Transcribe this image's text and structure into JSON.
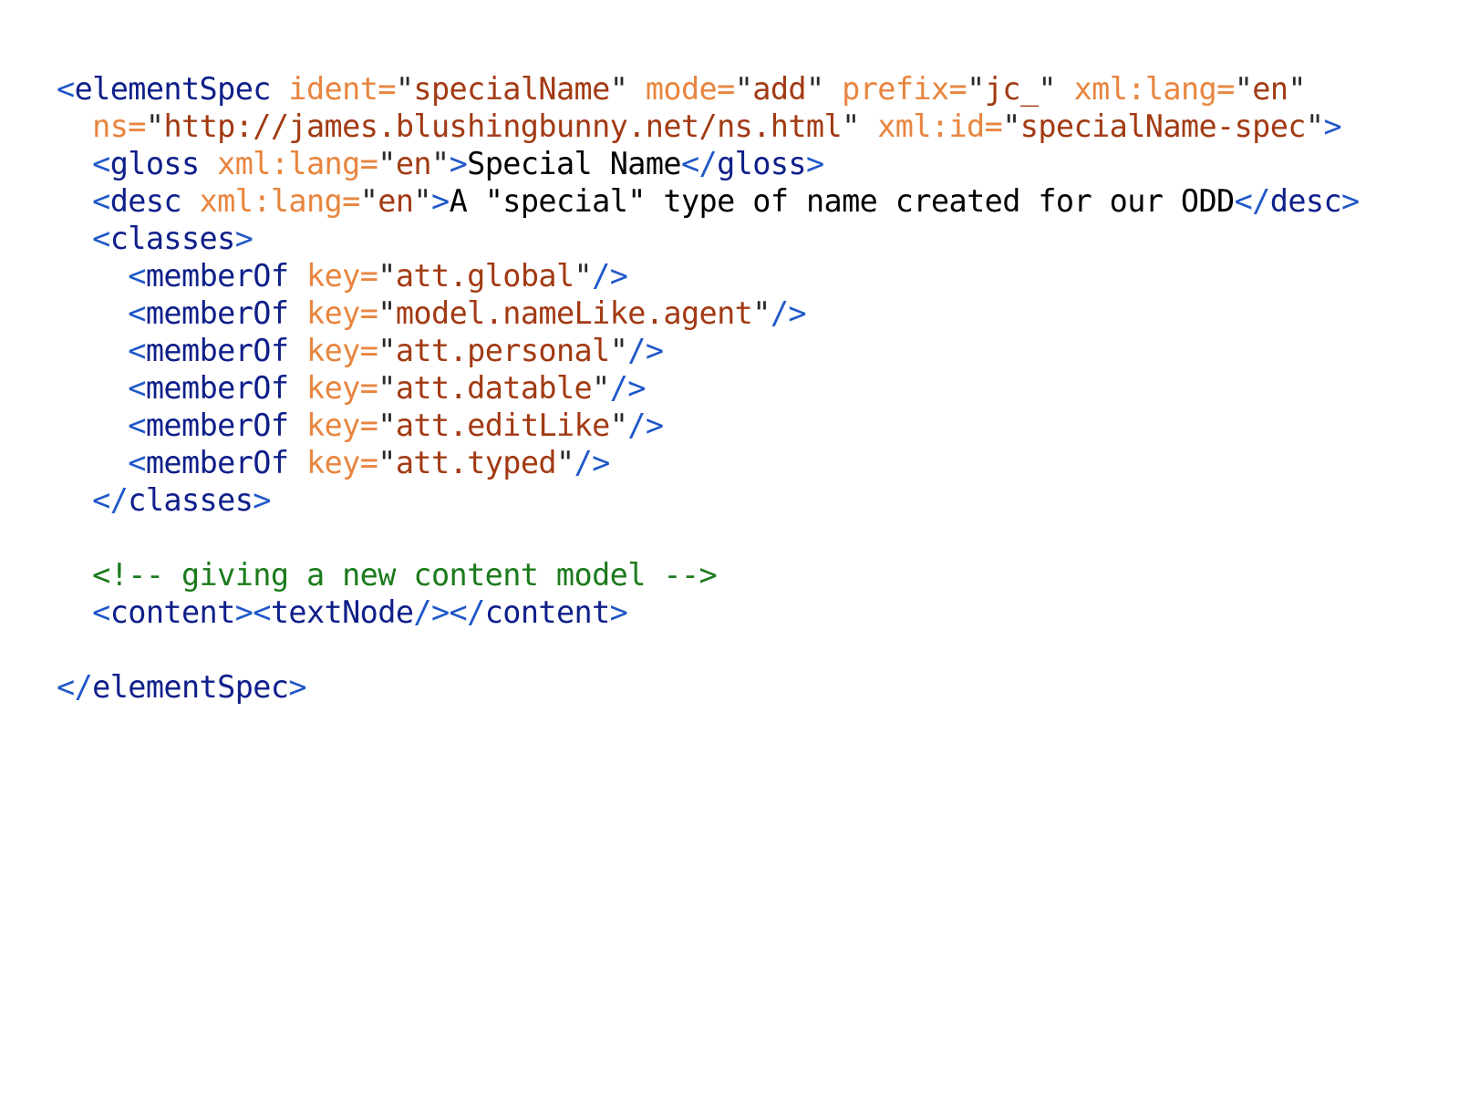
{
  "colors": {
    "punct": "#1f58c9",
    "element": "#0f1f8a",
    "attribute": "#e8853f",
    "value": "#a23a13",
    "text": "#000000",
    "comment": "#1b7a1b",
    "background": "#ffffff"
  },
  "lines": [
    [
      {
        "t": "punct",
        "v": "<"
      },
      {
        "t": "elem",
        "v": "elementSpec"
      },
      {
        "t": "space",
        "v": " "
      },
      {
        "t": "attr",
        "v": "ident="
      },
      {
        "t": "quote",
        "v": "\""
      },
      {
        "t": "val",
        "v": "specialName"
      },
      {
        "t": "quote",
        "v": "\""
      },
      {
        "t": "space",
        "v": " "
      },
      {
        "t": "attr",
        "v": "mode="
      },
      {
        "t": "quote",
        "v": "\""
      },
      {
        "t": "val",
        "v": "add"
      },
      {
        "t": "quote",
        "v": "\""
      },
      {
        "t": "space",
        "v": " "
      },
      {
        "t": "attr",
        "v": "prefix="
      },
      {
        "t": "quote",
        "v": "\""
      },
      {
        "t": "val",
        "v": "jc_"
      },
      {
        "t": "quote",
        "v": "\""
      },
      {
        "t": "space",
        "v": " "
      },
      {
        "t": "attr",
        "v": "xml:lang="
      },
      {
        "t": "quote",
        "v": "\""
      },
      {
        "t": "val",
        "v": "en"
      },
      {
        "t": "quote",
        "v": "\""
      }
    ],
    [
      {
        "t": "space",
        "v": "  "
      },
      {
        "t": "attr",
        "v": "ns="
      },
      {
        "t": "quote",
        "v": "\""
      },
      {
        "t": "val",
        "v": "http://james.blushingbunny.net/ns.html"
      },
      {
        "t": "quote",
        "v": "\""
      },
      {
        "t": "space",
        "v": " "
      },
      {
        "t": "attr",
        "v": "xml:id="
      },
      {
        "t": "quote",
        "v": "\""
      },
      {
        "t": "val",
        "v": "specialName-spec"
      },
      {
        "t": "quote",
        "v": "\""
      },
      {
        "t": "punct",
        "v": ">"
      }
    ],
    [
      {
        "t": "space",
        "v": "  "
      },
      {
        "t": "punct",
        "v": "<"
      },
      {
        "t": "elem",
        "v": "gloss"
      },
      {
        "t": "space",
        "v": " "
      },
      {
        "t": "attr",
        "v": "xml:lang="
      },
      {
        "t": "quote",
        "v": "\""
      },
      {
        "t": "val",
        "v": "en"
      },
      {
        "t": "quote",
        "v": "\""
      },
      {
        "t": "punct",
        "v": ">"
      },
      {
        "t": "text",
        "v": "Special Name"
      },
      {
        "t": "punct",
        "v": "</"
      },
      {
        "t": "elem",
        "v": "gloss"
      },
      {
        "t": "punct",
        "v": ">"
      }
    ],
    [
      {
        "t": "space",
        "v": "  "
      },
      {
        "t": "punct",
        "v": "<"
      },
      {
        "t": "elem",
        "v": "desc"
      },
      {
        "t": "space",
        "v": " "
      },
      {
        "t": "attr",
        "v": "xml:lang="
      },
      {
        "t": "quote",
        "v": "\""
      },
      {
        "t": "val",
        "v": "en"
      },
      {
        "t": "quote",
        "v": "\""
      },
      {
        "t": "punct",
        "v": ">"
      },
      {
        "t": "text",
        "v": "A \"special\" type of name created for our ODD"
      },
      {
        "t": "punct",
        "v": "</"
      },
      {
        "t": "elem",
        "v": "desc"
      },
      {
        "t": "punct",
        "v": ">"
      }
    ],
    [
      {
        "t": "space",
        "v": "  "
      },
      {
        "t": "punct",
        "v": "<"
      },
      {
        "t": "elem",
        "v": "classes"
      },
      {
        "t": "punct",
        "v": ">"
      }
    ],
    [
      {
        "t": "space",
        "v": "    "
      },
      {
        "t": "punct",
        "v": "<"
      },
      {
        "t": "elem",
        "v": "memberOf"
      },
      {
        "t": "space",
        "v": " "
      },
      {
        "t": "attr",
        "v": "key="
      },
      {
        "t": "quote",
        "v": "\""
      },
      {
        "t": "val",
        "v": "att.global"
      },
      {
        "t": "quote",
        "v": "\""
      },
      {
        "t": "punct",
        "v": "/>"
      }
    ],
    [
      {
        "t": "space",
        "v": "    "
      },
      {
        "t": "punct",
        "v": "<"
      },
      {
        "t": "elem",
        "v": "memberOf"
      },
      {
        "t": "space",
        "v": " "
      },
      {
        "t": "attr",
        "v": "key="
      },
      {
        "t": "quote",
        "v": "\""
      },
      {
        "t": "val",
        "v": "model.nameLike.agent"
      },
      {
        "t": "quote",
        "v": "\""
      },
      {
        "t": "punct",
        "v": "/>"
      }
    ],
    [
      {
        "t": "space",
        "v": "    "
      },
      {
        "t": "punct",
        "v": "<"
      },
      {
        "t": "elem",
        "v": "memberOf"
      },
      {
        "t": "space",
        "v": " "
      },
      {
        "t": "attr",
        "v": "key="
      },
      {
        "t": "quote",
        "v": "\""
      },
      {
        "t": "val",
        "v": "att.personal"
      },
      {
        "t": "quote",
        "v": "\""
      },
      {
        "t": "punct",
        "v": "/>"
      }
    ],
    [
      {
        "t": "space",
        "v": "    "
      },
      {
        "t": "punct",
        "v": "<"
      },
      {
        "t": "elem",
        "v": "memberOf"
      },
      {
        "t": "space",
        "v": " "
      },
      {
        "t": "attr",
        "v": "key="
      },
      {
        "t": "quote",
        "v": "\""
      },
      {
        "t": "val",
        "v": "att.datable"
      },
      {
        "t": "quote",
        "v": "\""
      },
      {
        "t": "punct",
        "v": "/>"
      }
    ],
    [
      {
        "t": "space",
        "v": "    "
      },
      {
        "t": "punct",
        "v": "<"
      },
      {
        "t": "elem",
        "v": "memberOf"
      },
      {
        "t": "space",
        "v": " "
      },
      {
        "t": "attr",
        "v": "key="
      },
      {
        "t": "quote",
        "v": "\""
      },
      {
        "t": "val",
        "v": "att.editLike"
      },
      {
        "t": "quote",
        "v": "\""
      },
      {
        "t": "punct",
        "v": "/>"
      }
    ],
    [
      {
        "t": "space",
        "v": "    "
      },
      {
        "t": "punct",
        "v": "<"
      },
      {
        "t": "elem",
        "v": "memberOf"
      },
      {
        "t": "space",
        "v": " "
      },
      {
        "t": "attr",
        "v": "key="
      },
      {
        "t": "quote",
        "v": "\""
      },
      {
        "t": "val",
        "v": "att.typed"
      },
      {
        "t": "quote",
        "v": "\""
      },
      {
        "t": "punct",
        "v": "/>"
      }
    ],
    [
      {
        "t": "space",
        "v": "  "
      },
      {
        "t": "punct",
        "v": "</"
      },
      {
        "t": "elem",
        "v": "classes"
      },
      {
        "t": "punct",
        "v": ">"
      }
    ],
    [],
    [
      {
        "t": "space",
        "v": "  "
      },
      {
        "t": "comment",
        "v": "<!-- giving a new content model -->"
      }
    ],
    [
      {
        "t": "space",
        "v": "  "
      },
      {
        "t": "punct",
        "v": "<"
      },
      {
        "t": "elem",
        "v": "content"
      },
      {
        "t": "punct",
        "v": "><"
      },
      {
        "t": "elem",
        "v": "textNode"
      },
      {
        "t": "punct",
        "v": "/></"
      },
      {
        "t": "elem",
        "v": "content"
      },
      {
        "t": "punct",
        "v": ">"
      }
    ],
    [],
    [
      {
        "t": "punct",
        "v": "</"
      },
      {
        "t": "elem",
        "v": "elementSpec"
      },
      {
        "t": "punct",
        "v": ">"
      }
    ]
  ]
}
